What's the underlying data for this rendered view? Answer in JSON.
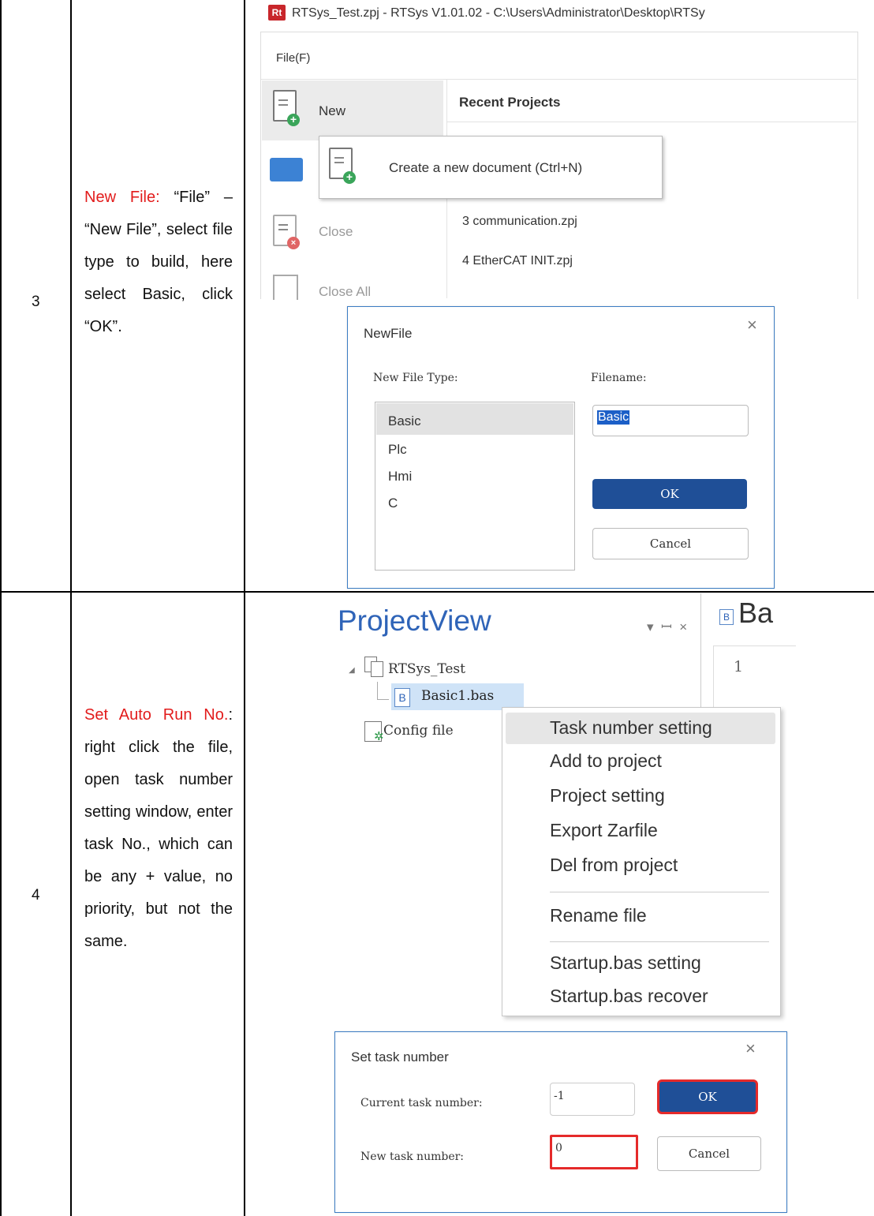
{
  "rows": [
    {
      "number": "3",
      "desc_red": "New File:",
      "desc_text": " “File” – “New File”, select file type to build, here select Basic, click “OK”."
    },
    {
      "number": "4",
      "desc_red": "Set Auto Run No.",
      "desc_text": ": right click the file, open task number setting window, enter task No., which can be any + value, no priority, but not the same."
    }
  ],
  "rtsys_window": {
    "logo": "Rt",
    "title": "RTSys_Test.zpj - RTSys V1.01.02 - C:\\Users\\Administrator\\Desktop\\RTSy",
    "menu_file": "File(F)",
    "new_label": "New",
    "close_label": "Close",
    "close_all_label": "Close All",
    "recent_header": "Recent Projects",
    "tooltip": "Create a new document (Ctrl+N)",
    "recent_items": [
      "3 communication.zpj",
      "4 EtherCAT INIT.zpj"
    ]
  },
  "newfile_dialog": {
    "title": "NewFile",
    "type_label": "New File Type:",
    "filename_label": "Filename:",
    "types": [
      "Basic",
      "Plc",
      "Hmi",
      "C"
    ],
    "selected_type": "Basic",
    "filename_value": "Basic",
    "ok": "OK",
    "cancel": "Cancel"
  },
  "project_view": {
    "title": "ProjectView",
    "pane_controls": "▾  ꟷ  ×",
    "tab_label": "Ba",
    "line_number": "1",
    "root": "RTSys_Test",
    "file": "Basic1.bas",
    "config": "Config file"
  },
  "context_menu": {
    "items": [
      "Task number setting",
      "Add to project",
      "Project setting",
      "Export Zarfile",
      "Del from project",
      "Rename file",
      "Startup.bas setting",
      "Startup.bas recover"
    ]
  },
  "task_dialog": {
    "title": "Set task number",
    "current_label": "Current task number:",
    "current_value": "-1",
    "new_label": "New task number:",
    "new_value": "0",
    "ok": "OK",
    "cancel": "Cancel"
  },
  "colors": {
    "accent_red": "#e21c1c",
    "ok_blue": "#1f4f97",
    "dialog_border": "#3c7dc4",
    "highlight_red": "#e52a2a"
  }
}
